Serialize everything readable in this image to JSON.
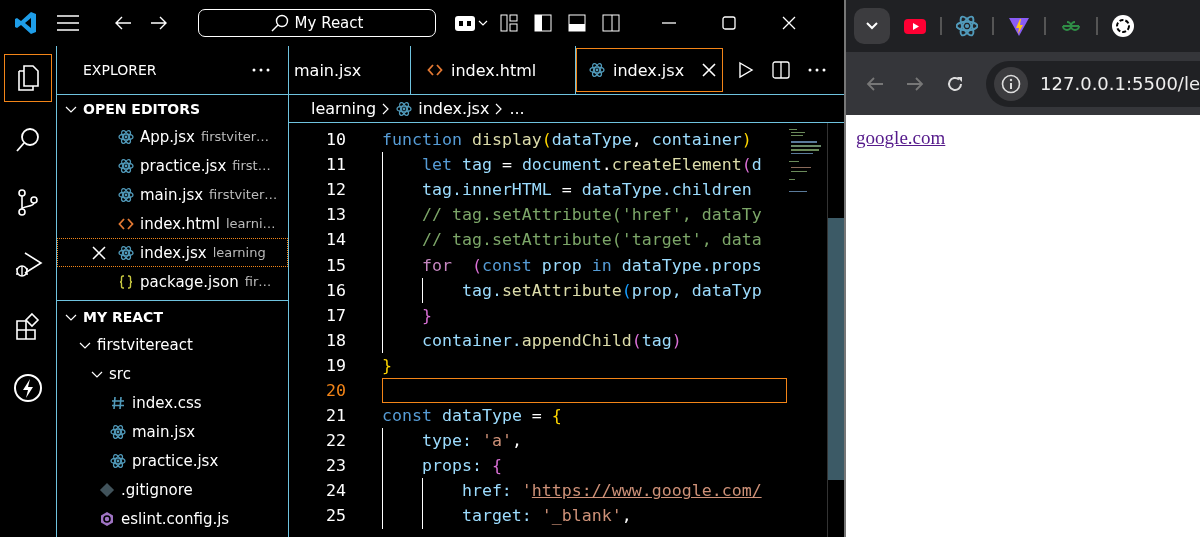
{
  "titlebar": {
    "search": "My React"
  },
  "activity_bar": [
    {
      "kind": "files",
      "selected": true
    },
    {
      "kind": "search",
      "selected": false
    },
    {
      "kind": "source-control",
      "selected": false
    },
    {
      "kind": "run-debug",
      "selected": false
    },
    {
      "kind": "extensions",
      "selected": false
    },
    {
      "kind": "lightning",
      "selected": false
    }
  ],
  "sidebar": {
    "title": "EXPLORER",
    "open_editors": {
      "title": "OPEN EDITORS",
      "expanded": true,
      "items": [
        {
          "kind": "react",
          "name": "App.jsx",
          "description": "firstviter…",
          "focused": false
        },
        {
          "kind": "react",
          "name": "practice.jsx",
          "description": "first…",
          "focused": false
        },
        {
          "kind": "react",
          "name": "main.jsx",
          "description": "firstviter…",
          "focused": false
        },
        {
          "kind": "html",
          "name": "index.html",
          "description": "learni…",
          "focused": false
        },
        {
          "kind": "react",
          "name": "index.jsx",
          "description": "learning",
          "focused": true
        },
        {
          "kind": "json",
          "name": "package.json",
          "description": "fir…",
          "focused": false
        }
      ]
    },
    "project": {
      "title": "MY REACT",
      "expanded": true,
      "tree": [
        {
          "kind": "folder",
          "name": "firstvitereact",
          "expanded": true,
          "children": [
            {
              "kind": "folder",
              "name": "src",
              "expanded": true,
              "children": [
                {
                  "kind": "css",
                  "name": "index.css"
                },
                {
                  "kind": "react",
                  "name": "main.jsx"
                },
                {
                  "kind": "react",
                  "name": "practice.jsx"
                }
              ]
            },
            {
              "kind": "git",
              "name": ".gitignore"
            },
            {
              "kind": "eslint",
              "name": "eslint.config.js"
            }
          ]
        }
      ]
    }
  },
  "editor": {
    "tabs": [
      {
        "kind": "none",
        "label": "main.jsx",
        "selected": false
      },
      {
        "kind": "html",
        "label": "index.html",
        "selected": false
      },
      {
        "kind": "react",
        "label": "index.jsx",
        "selected": true
      }
    ],
    "breadcrumb": [
      {
        "kind": "folder",
        "text": "learning"
      },
      {
        "kind": "react",
        "text": "index.jsx"
      },
      {
        "kind": "symbol",
        "text": "..."
      }
    ],
    "lines": [
      {
        "number": "10",
        "current": false,
        "tokens": [
          {
            "text": "function ",
            "kind": "kw"
          },
          {
            "text": "display",
            "kind": "fn"
          },
          {
            "text": "(",
            "kind": "b1"
          },
          {
            "text": "dataType",
            "kind": "var"
          },
          {
            "text": ", ",
            "kind": "pun"
          },
          {
            "text": "container",
            "kind": "var"
          },
          {
            "text": ")",
            "kind": "b1"
          }
        ]
      },
      {
        "number": "11",
        "current": false,
        "tokens": [
          {
            "kind": "ind"
          },
          {
            "text": "let",
            "kind": "kw"
          },
          {
            "text": " tag ",
            "kind": "var"
          },
          {
            "text": "= ",
            "kind": "pun"
          },
          {
            "text": "document",
            "kind": "var"
          },
          {
            "text": ".",
            "kind": "pun"
          },
          {
            "text": "createElement",
            "kind": "fn"
          },
          {
            "text": "(",
            "kind": "b2"
          },
          {
            "text": "d",
            "kind": "var"
          }
        ]
      },
      {
        "number": "12",
        "current": false,
        "tokens": [
          {
            "kind": "ind"
          },
          {
            "text": "tag.innerHTML",
            "kind": "var"
          },
          {
            "text": " = ",
            "kind": "pun"
          },
          {
            "text": "dataType.children",
            "kind": "var"
          }
        ]
      },
      {
        "number": "13",
        "current": false,
        "tokens": [
          {
            "kind": "ind"
          },
          {
            "text": "// tag.setAttribute('href', dataTy",
            "kind": "cmt"
          }
        ]
      },
      {
        "number": "14",
        "current": false,
        "tokens": [
          {
            "kind": "ind"
          },
          {
            "text": "// tag.setAttribute('target', data",
            "kind": "cmt"
          }
        ]
      },
      {
        "number": "15",
        "current": false,
        "tokens": [
          {
            "kind": "ind"
          },
          {
            "text": "for  ",
            "kind": "ctl"
          },
          {
            "text": "(",
            "kind": "b2"
          },
          {
            "text": "const",
            "kind": "kw"
          },
          {
            "text": " prop ",
            "kind": "var"
          },
          {
            "text": "in",
            "kind": "kw"
          },
          {
            "text": " dataType.props",
            "kind": "var"
          }
        ]
      },
      {
        "number": "16",
        "current": false,
        "tokens": [
          {
            "kind": "ind"
          },
          {
            "kind": "ind"
          },
          {
            "text": "tag.",
            "kind": "var"
          },
          {
            "text": "setAttribute",
            "kind": "fn"
          },
          {
            "text": "(",
            "kind": "b3"
          },
          {
            "text": "prop, dataTyp",
            "kind": "var"
          }
        ]
      },
      {
        "number": "17",
        "current": false,
        "tokens": [
          {
            "kind": "ind"
          },
          {
            "text": "}",
            "kind": "b2"
          }
        ]
      },
      {
        "number": "18",
        "current": false,
        "tokens": [
          {
            "kind": "ind"
          },
          {
            "text": "container.",
            "kind": "var"
          },
          {
            "text": "appendChild",
            "kind": "fn"
          },
          {
            "text": "(",
            "kind": "b2"
          },
          {
            "text": "tag",
            "kind": "var"
          },
          {
            "text": ")",
            "kind": "b2"
          }
        ]
      },
      {
        "number": "19",
        "current": false,
        "tokens": [
          {
            "text": "}",
            "kind": "b1"
          }
        ]
      },
      {
        "number": "20",
        "current": true
      },
      {
        "number": "21",
        "current": false,
        "tokens": [
          {
            "text": "const",
            "kind": "kw"
          },
          {
            "text": " dataType ",
            "kind": "var"
          },
          {
            "text": "= ",
            "kind": "pun"
          },
          {
            "text": "{",
            "kind": "b1"
          }
        ]
      },
      {
        "number": "22",
        "current": false,
        "tokens": [
          {
            "kind": "ind"
          },
          {
            "text": "type: ",
            "kind": "var"
          },
          {
            "text": "'a'",
            "kind": "str"
          },
          {
            "text": ",",
            "kind": "pun"
          }
        ]
      },
      {
        "number": "23",
        "current": false,
        "tokens": [
          {
            "kind": "ind"
          },
          {
            "text": "props: ",
            "kind": "var"
          },
          {
            "text": "{",
            "kind": "b2"
          }
        ]
      },
      {
        "number": "24",
        "current": false,
        "tokens": [
          {
            "kind": "ind"
          },
          {
            "kind": "ind"
          },
          {
            "text": "href: ",
            "kind": "var"
          },
          {
            "text": "'",
            "kind": "str"
          },
          {
            "text": "https://www.google.com/",
            "kind": "link"
          }
        ]
      },
      {
        "number": "25",
        "current": false,
        "tokens": [
          {
            "kind": "ind"
          },
          {
            "kind": "ind"
          },
          {
            "text": "target: ",
            "kind": "var"
          },
          {
            "text": "'_blank'",
            "kind": "str"
          },
          {
            "text": ",",
            "kind": "pun"
          }
        ]
      }
    ]
  },
  "browser": {
    "favicons": [
      {
        "kind": "youtube"
      },
      {
        "kind": "react"
      },
      {
        "kind": "vite"
      },
      {
        "kind": "gfg"
      },
      {
        "kind": "openai"
      }
    ],
    "address": "127.0.0.1:5500/le",
    "link": "google.com"
  }
}
